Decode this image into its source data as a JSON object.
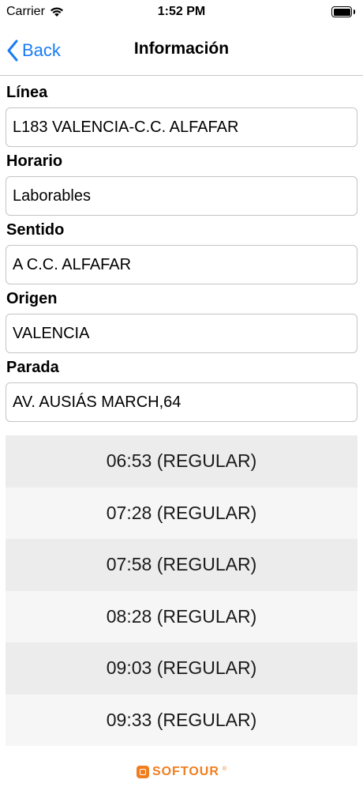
{
  "status_bar": {
    "carrier": "Carrier",
    "time": "1:52 PM"
  },
  "nav": {
    "back_label": "Back",
    "title": "Información"
  },
  "fields": [
    {
      "label": "Línea",
      "value": "L183 VALENCIA-C.C. ALFAFAR"
    },
    {
      "label": "Horario",
      "value": "Laborables"
    },
    {
      "label": "Sentido",
      "value": "A C.C. ALFAFAR"
    },
    {
      "label": "Origen",
      "value": "VALENCIA"
    },
    {
      "label": "Parada",
      "value": "AV. AUSIÁS MARCH,64"
    }
  ],
  "schedule": [
    "06:53 (REGULAR)",
    "07:28 (REGULAR)",
    "07:58 (REGULAR)",
    "08:28 (REGULAR)",
    "09:03 (REGULAR)",
    "09:33 (REGULAR)"
  ],
  "footer": {
    "logo_text": "SOFTOUR",
    "logo_reg": "®"
  },
  "colors": {
    "accent": "#1a7cf5",
    "brand": "#f07e1e"
  }
}
